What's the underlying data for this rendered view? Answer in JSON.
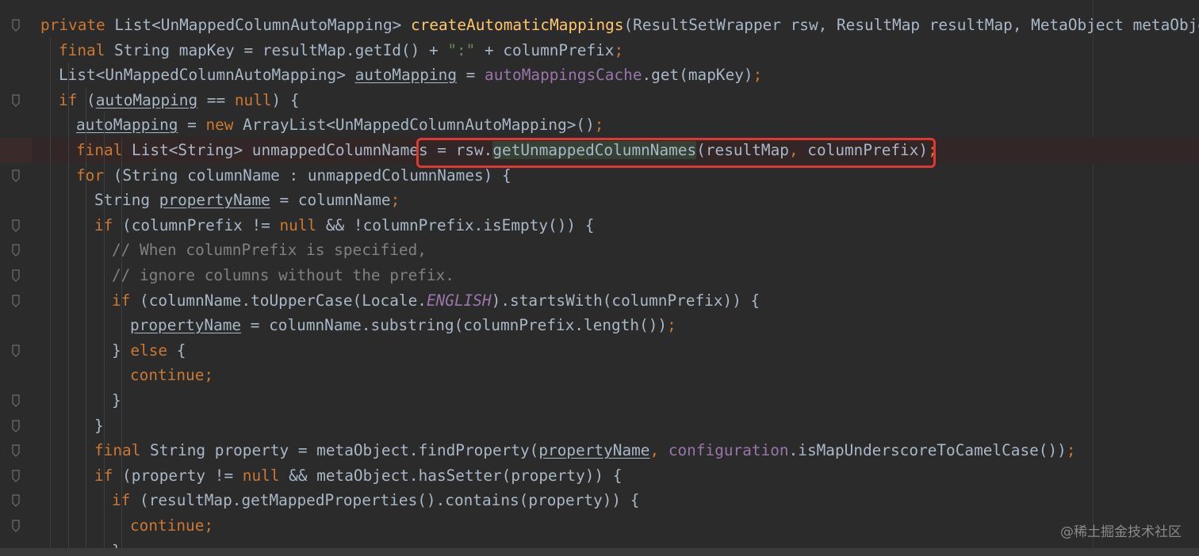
{
  "editor": {
    "lines": [
      [
        {
          "t": "private ",
          "c": "kw"
        },
        {
          "t": "List<UnMappedColumnAutoMapping> ",
          "c": ""
        },
        {
          "t": "createAutomaticMappings",
          "c": "fn"
        },
        {
          "t": "(ResultSetWrapper rsw, ResultMap resultMap, MetaObject metaObject,",
          "c": ""
        }
      ],
      [
        {
          "t": "final ",
          "c": "kw"
        },
        {
          "t": "String mapKey = resultMap.getId() + ",
          "c": ""
        },
        {
          "t": "\":\"",
          "c": "str"
        },
        {
          "t": " + columnPrefix",
          "c": ""
        },
        {
          "t": ";",
          "c": "kw"
        }
      ],
      [
        {
          "t": "List<UnMappedColumnAutoMapping> ",
          "c": ""
        },
        {
          "t": "autoMapping",
          "c": "ul"
        },
        {
          "t": " = ",
          "c": ""
        },
        {
          "t": "autoMappingsCache",
          "c": "fld"
        },
        {
          "t": ".get(mapKey)",
          "c": ""
        },
        {
          "t": ";",
          "c": "kw"
        }
      ],
      [
        {
          "t": "if ",
          "c": "kw"
        },
        {
          "t": "(",
          "c": ""
        },
        {
          "t": "autoMapping",
          "c": "ul"
        },
        {
          "t": " == ",
          "c": ""
        },
        {
          "t": "null",
          "c": "kw"
        },
        {
          "t": ") {",
          "c": ""
        }
      ],
      [
        {
          "t": "autoMapping",
          "c": "ul"
        },
        {
          "t": " = ",
          "c": ""
        },
        {
          "t": "new ",
          "c": "kw"
        },
        {
          "t": "ArrayList<UnMappedColumnAutoMapping>()",
          "c": ""
        },
        {
          "t": ";",
          "c": "kw"
        }
      ],
      [
        {
          "t": "final ",
          "c": "kw"
        },
        {
          "t": "List<String> unmappedColumnNames = rsw.",
          "c": ""
        },
        {
          "t": "getUnmappedColumnNames",
          "c": "hl"
        },
        {
          "t": "(resultMap",
          "c": ""
        },
        {
          "t": ", ",
          "c": "kw"
        },
        {
          "t": "columnPrefix)",
          "c": ""
        },
        {
          "t": ";",
          "c": "kw"
        }
      ],
      [
        {
          "t": "for ",
          "c": "kw"
        },
        {
          "t": "(String columnName : unmappedColumnNames) {",
          "c": ""
        }
      ],
      [
        {
          "t": "String ",
          "c": ""
        },
        {
          "t": "propertyName",
          "c": "ul"
        },
        {
          "t": " = columnName",
          "c": ""
        },
        {
          "t": ";",
          "c": "kw"
        }
      ],
      [
        {
          "t": "if ",
          "c": "kw"
        },
        {
          "t": "(columnPrefix != ",
          "c": ""
        },
        {
          "t": "null ",
          "c": "kw"
        },
        {
          "t": "&& !columnPrefix.isEmpty()) {",
          "c": ""
        }
      ],
      [
        {
          "t": "// When columnPrefix is specified,",
          "c": "cmt"
        }
      ],
      [
        {
          "t": "// ignore columns without the prefix.",
          "c": "cmt"
        }
      ],
      [
        {
          "t": "if ",
          "c": "kw"
        },
        {
          "t": "(columnName.toUpperCase(Locale.",
          "c": ""
        },
        {
          "t": "ENGLISH",
          "c": "ital"
        },
        {
          "t": ").startsWith(columnPrefix)) {",
          "c": ""
        }
      ],
      [
        {
          "t": "propertyName",
          "c": "ul"
        },
        {
          "t": " = columnName.substring(columnPrefix.length())",
          "c": ""
        },
        {
          "t": ";",
          "c": "kw"
        }
      ],
      [
        {
          "t": "} ",
          "c": ""
        },
        {
          "t": "else ",
          "c": "kw"
        },
        {
          "t": "{",
          "c": ""
        }
      ],
      [
        {
          "t": "continue;",
          "c": "kw"
        }
      ],
      [
        {
          "t": "}",
          "c": ""
        }
      ],
      [
        {
          "t": "}",
          "c": ""
        }
      ],
      [
        {
          "t": "final ",
          "c": "kw"
        },
        {
          "t": "String property = metaObject.findProperty(",
          "c": ""
        },
        {
          "t": "propertyName",
          "c": "ul"
        },
        {
          "t": ", ",
          "c": "kw"
        },
        {
          "t": "configuration",
          "c": "fld"
        },
        {
          "t": ".isMapUnderscoreToCamelCase())",
          "c": ""
        },
        {
          "t": ";",
          "c": "kw"
        }
      ],
      [
        {
          "t": "if ",
          "c": "kw"
        },
        {
          "t": "(property != ",
          "c": ""
        },
        {
          "t": "null ",
          "c": "kw"
        },
        {
          "t": "&& metaObject.hasSetter(property)) {",
          "c": ""
        }
      ],
      [
        {
          "t": "if ",
          "c": "kw"
        },
        {
          "t": "(resultMap.getMappedProperties().contains(property)) {",
          "c": ""
        }
      ],
      [
        {
          "t": "continue;",
          "c": "kw"
        }
      ],
      [
        {
          "t": "}",
          "c": ""
        }
      ]
    ]
  },
  "watermark": "@稀土掘金技术社区",
  "colors": {
    "background": "#2b2b2b",
    "keyword": "#cc7832",
    "method": "#ffc66d",
    "field": "#9876aa",
    "string": "#6a8759",
    "comment": "#808080",
    "text": "#a9b7c6",
    "box": "#e0382e"
  }
}
